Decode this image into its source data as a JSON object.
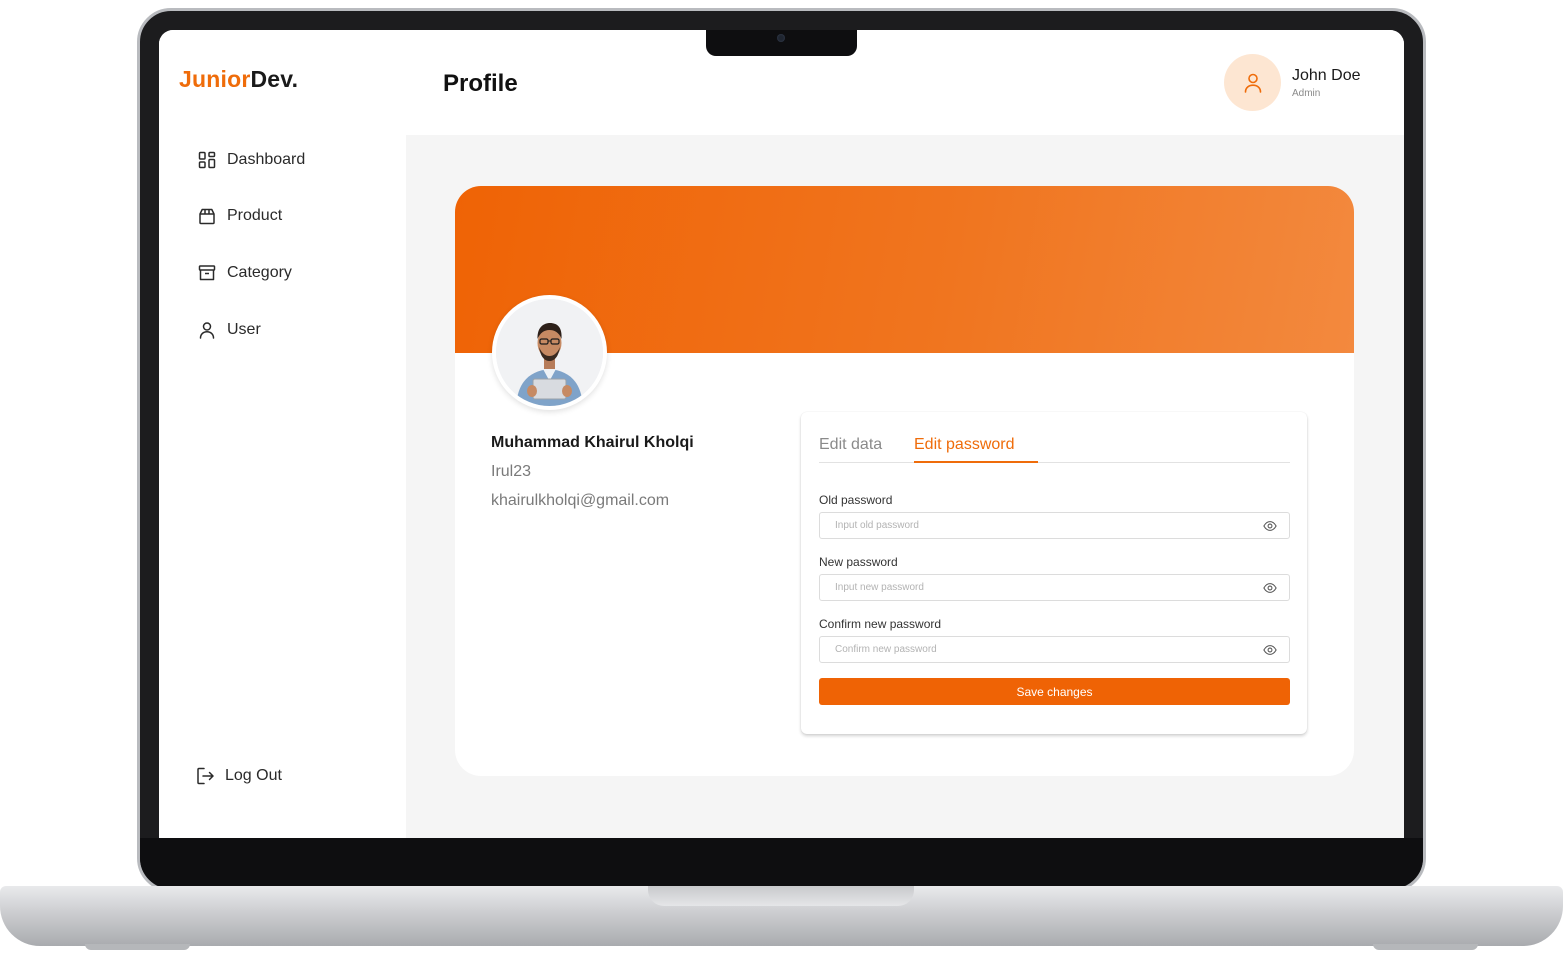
{
  "brand": {
    "part1": "Junior",
    "part2": "Dev.",
    "accent": "#ef6c0a"
  },
  "sidebar": {
    "items": [
      {
        "label": "Dashboard",
        "icon": "grid-icon"
      },
      {
        "label": "Product",
        "icon": "box-icon"
      },
      {
        "label": "Category",
        "icon": "archive-icon"
      },
      {
        "label": "User",
        "icon": "user-icon"
      }
    ],
    "logout": {
      "label": "Log Out",
      "icon": "logout-icon"
    }
  },
  "header": {
    "title": "Profile",
    "user": {
      "name": "John Doe",
      "role": "Admin",
      "avatar_icon": "user-icon"
    }
  },
  "profile": {
    "full_name": "Muhammad Khairul Kholqi",
    "username": "Irul23",
    "email": "khairulkholqi@gmail.com"
  },
  "tabs": [
    {
      "label": "Edit data",
      "active": false
    },
    {
      "label": "Edit password",
      "active": true
    }
  ],
  "form": {
    "old_password": {
      "label": "Old password",
      "placeholder": "Input old password",
      "value": ""
    },
    "new_password": {
      "label": "New password",
      "placeholder": "Input new password",
      "value": ""
    },
    "confirm_password": {
      "label": "Confirm new password",
      "placeholder": "Confirm new password",
      "value": ""
    },
    "submit_label": "Save changes"
  }
}
